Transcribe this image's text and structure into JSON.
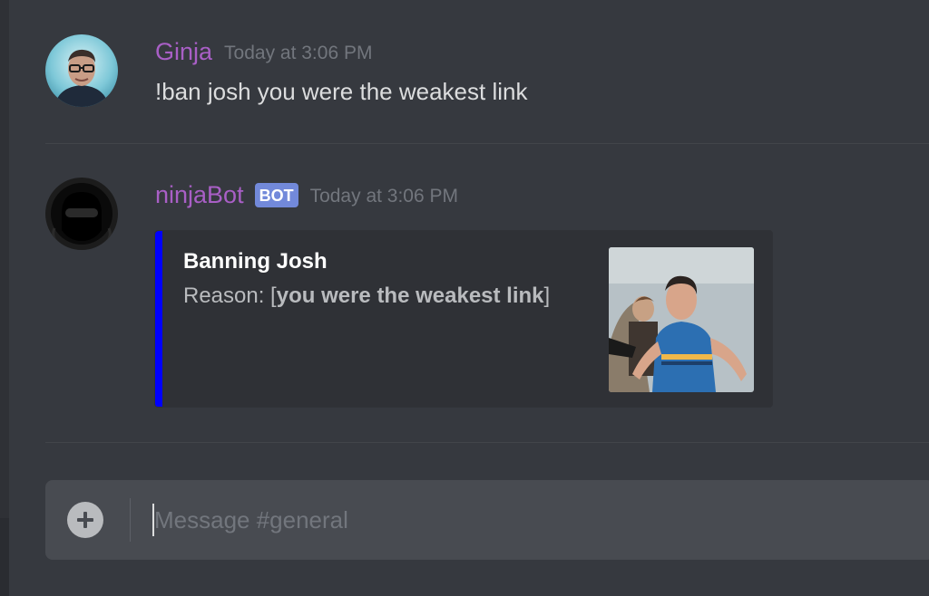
{
  "colors": {
    "background": "#36393f",
    "username": "#a95fc6",
    "bot_tag": "#7289da",
    "embed_accent": "#0000ff",
    "composer": "#484b51"
  },
  "messages": [
    {
      "author": "Ginja",
      "timestamp": "Today at 3:06 PM",
      "content": "!ban josh you were the weakest link",
      "avatar": "user-photo-avatar"
    },
    {
      "author": "ninjaBot",
      "bot_tag": "BOT",
      "timestamp": "Today at 3:06 PM",
      "avatar": "ninja-mask-avatar",
      "embed": {
        "title": "Banning Josh",
        "reason_prefix": "Reason: [",
        "reason": "you were the weakest link",
        "reason_suffix": "]",
        "thumbnail": "banned-user-photo"
      }
    }
  ],
  "composer": {
    "placeholder": "Message #general",
    "value": "",
    "attach_icon": "plus-circle-icon"
  }
}
